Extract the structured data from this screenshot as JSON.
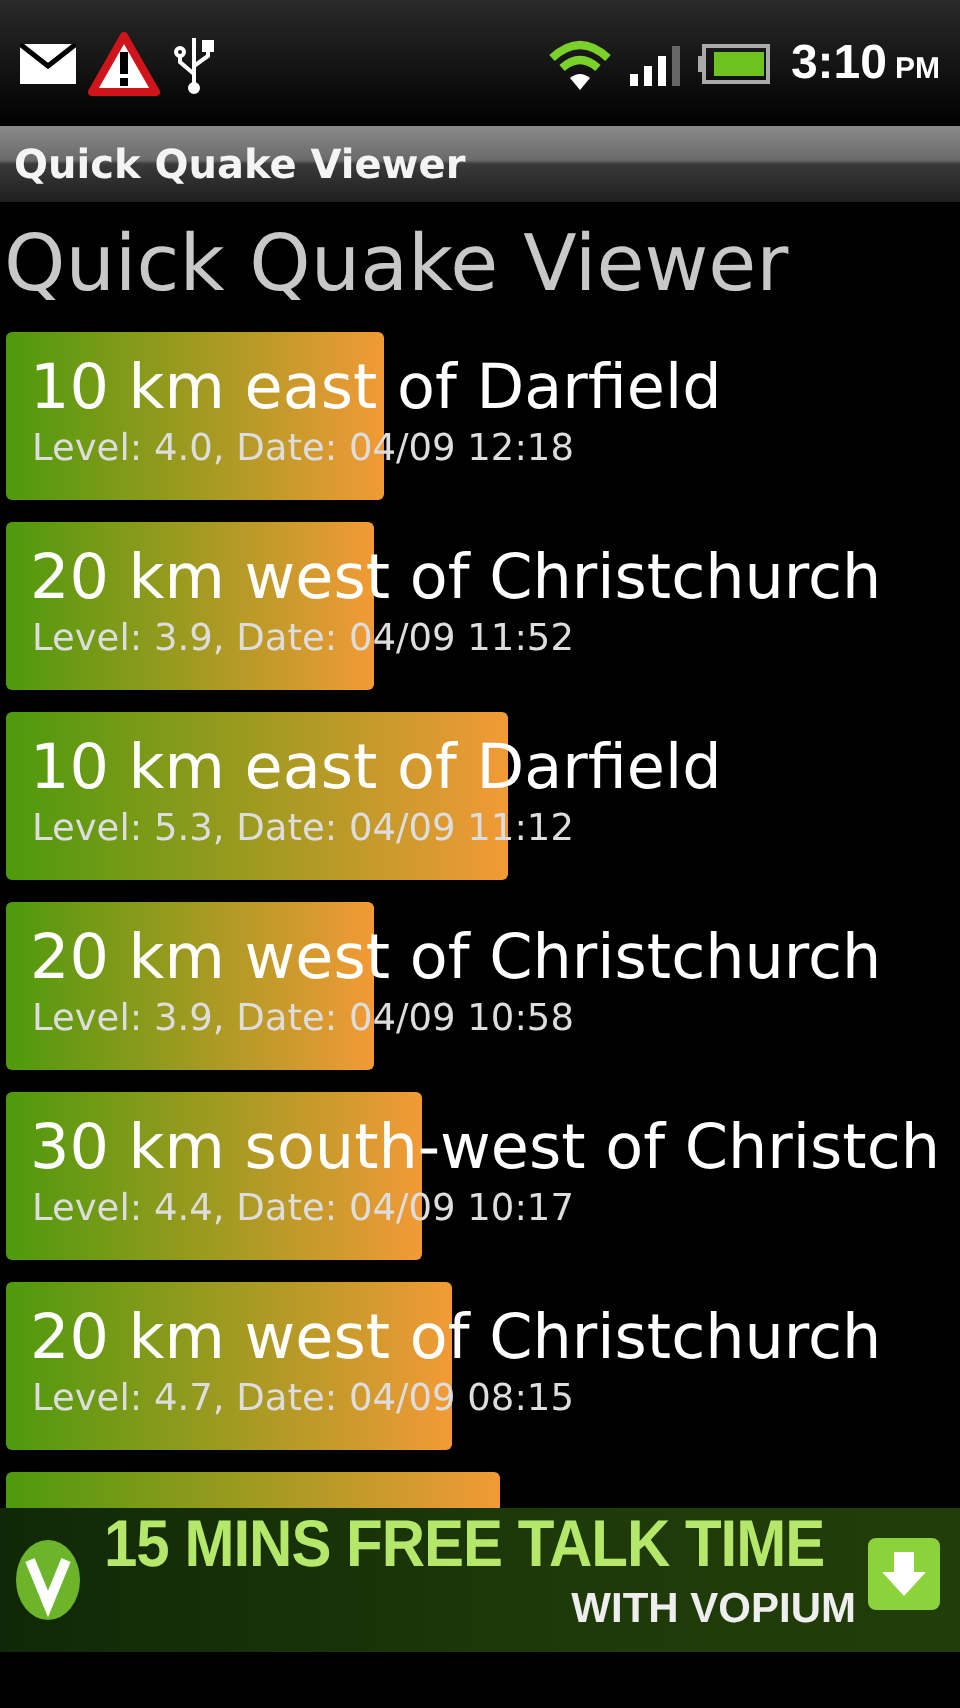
{
  "status_bar": {
    "time": "3:10",
    "ampm": "PM"
  },
  "title_bar": {
    "title": "Quick Quake Viewer"
  },
  "heading": "Quick Quake Viewer",
  "quakes": [
    {
      "kind": "full",
      "title": "10 km east of Darfield",
      "detail": "Level: 4.0, Date: 04/09 12:18"
    },
    {
      "kind": "full",
      "title": "20 km west of Christchurch",
      "detail": "Level: 3.9, Date: 04/09 11:52"
    },
    {
      "kind": "full",
      "title": "10 km east of Darfield",
      "detail": "Level: 5.3, Date: 04/09 11:12"
    },
    {
      "kind": "full",
      "title": "20 km west of Christchurch",
      "detail": "Level: 3.9, Date: 04/09 10:58"
    },
    {
      "kind": "full",
      "title": "30 km south-west of Christch",
      "detail": "Level: 4.4, Date: 04/09 10:17"
    },
    {
      "kind": "full",
      "title": "20 km west of Christchurch",
      "detail": "Level: 4.7, Date: 04/09 08:15"
    },
    {
      "kind": "hidden"
    }
  ],
  "ad_banner": {
    "headline": "15 MINS FREE TALK TIME",
    "subline": "WITH VOPIUM"
  }
}
